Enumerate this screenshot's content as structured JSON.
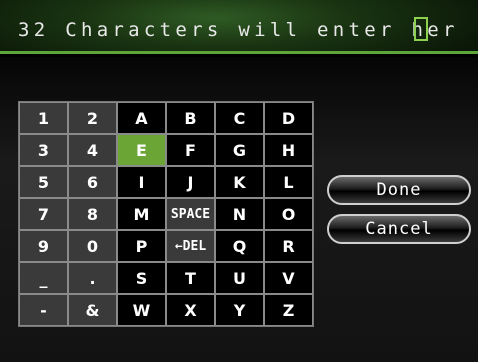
{
  "header": {
    "text": "32 Characters will enter her"
  },
  "keyboard": {
    "selected": "E",
    "rows": [
      [
        "1",
        "2",
        "A",
        "B",
        "C",
        "D"
      ],
      [
        "3",
        "4",
        "E",
        "F",
        "G",
        "H"
      ],
      [
        "5",
        "6",
        "I",
        "J",
        "K",
        "L"
      ],
      [
        "7",
        "8",
        "M",
        "SPACE",
        "N",
        "O"
      ],
      [
        "9",
        "0",
        "P",
        "←DEL",
        "Q",
        "R"
      ],
      [
        "_",
        ".",
        "S",
        "T",
        "U",
        "V"
      ],
      [
        "-",
        "&",
        "W",
        "X",
        "Y",
        "Z"
      ]
    ]
  },
  "buttons": {
    "done": "Done",
    "cancel": "Cancel"
  },
  "colors": {
    "accent": "#6aa535",
    "header_bg": "#1a3512"
  }
}
